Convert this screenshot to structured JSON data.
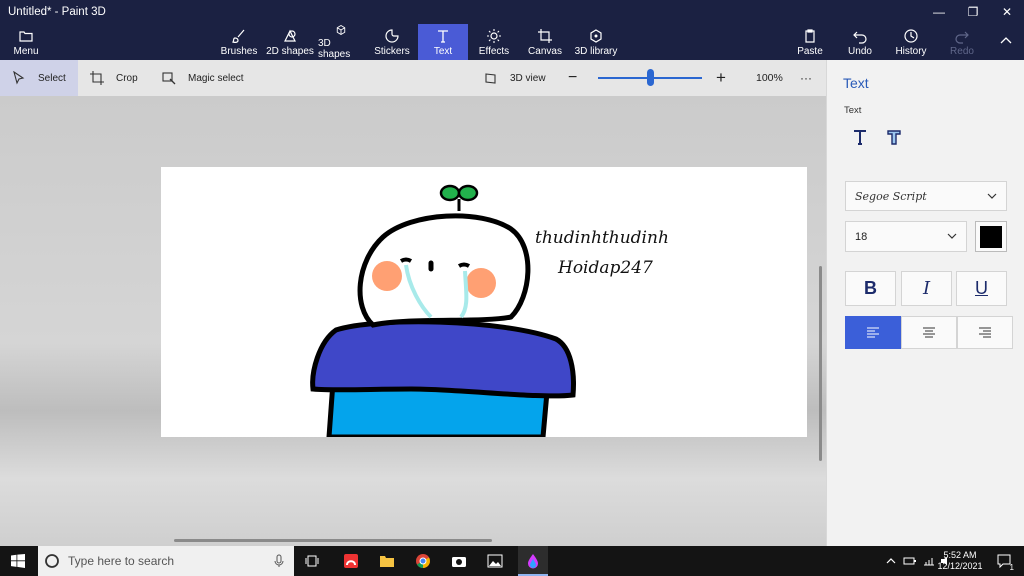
{
  "window": {
    "title": "Untitled* - Paint 3D",
    "controls": [
      "—",
      "❐",
      "✕"
    ]
  },
  "ribbon": {
    "menu": "Menu",
    "tools": [
      {
        "label": "Brushes",
        "icon": "brush-icon"
      },
      {
        "label": "2D shapes",
        "icon": "shapes-2d-icon"
      },
      {
        "label": "3D shapes",
        "icon": "cube-icon"
      },
      {
        "label": "Stickers",
        "icon": "sticker-icon"
      },
      {
        "label": "Text",
        "icon": "text-icon",
        "active": true
      },
      {
        "label": "Effects",
        "icon": "sun-icon"
      },
      {
        "label": "Canvas",
        "icon": "canvas-icon"
      },
      {
        "label": "3D library",
        "icon": "library-icon"
      }
    ],
    "paste": "Paste",
    "undo": "Undo",
    "history": "History",
    "redo": "Redo"
  },
  "toolbar": {
    "select": "Select",
    "crop": "Crop",
    "magic_select": "Magic select",
    "view_3d": "3D view",
    "zoom_out": "−",
    "zoom_in": "+",
    "zoom_level": "100%",
    "zoom_value": 0.5,
    "more": "···"
  },
  "canvas": {
    "text_line1": "thudinhthudinh",
    "text_line2": "Hoidap247"
  },
  "panel": {
    "title": "Text",
    "sub": "Text",
    "font": "Segoe Script",
    "size": "18",
    "bold": "B",
    "italic": "I",
    "underline": "U",
    "text_color": "#000000",
    "accent": "#3b5fd9"
  },
  "taskbar": {
    "search_placeholder": "Type here to search",
    "time": "5:52 AM",
    "date": "12/12/2021",
    "notification_count": "1"
  }
}
